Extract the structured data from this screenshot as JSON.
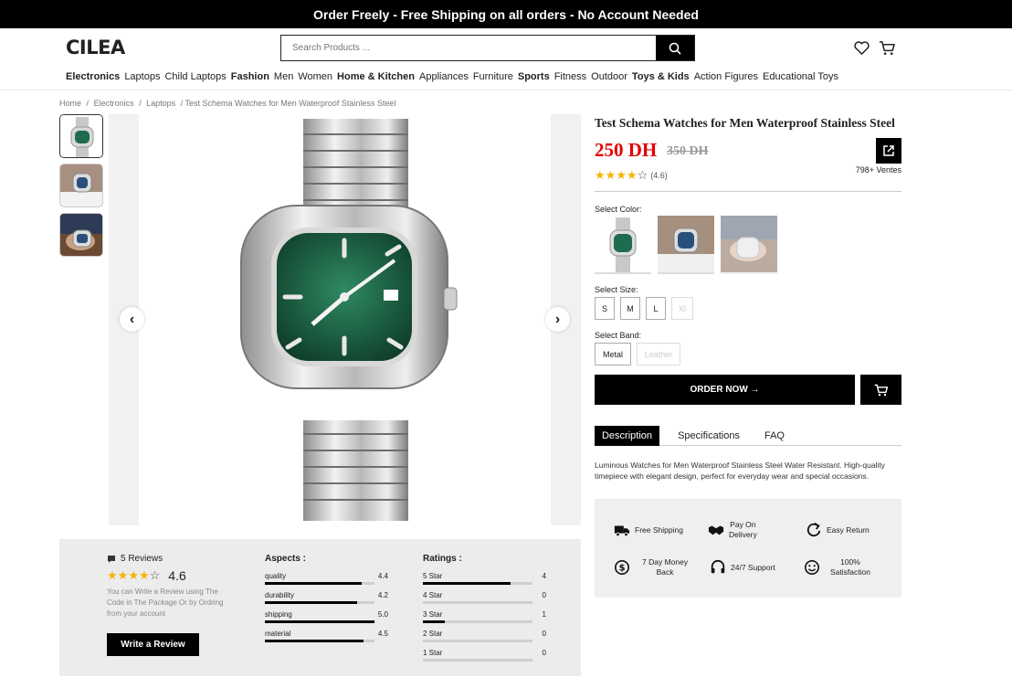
{
  "banner": "Order Freely - Free Shipping on all orders - No Account Needed",
  "header": {
    "logo": "CILEA",
    "search_placeholder": "Search Products ...",
    "icons": [
      "search-icon",
      "heart-icon",
      "cart-icon"
    ]
  },
  "nav": [
    {
      "label": "Electronics",
      "bold": true
    },
    {
      "label": "Laptops",
      "bold": false
    },
    {
      "label": "Child Laptops",
      "bold": false
    },
    {
      "label": "Fashion",
      "bold": true
    },
    {
      "label": "Men",
      "bold": false
    },
    {
      "label": "Women",
      "bold": false
    },
    {
      "label": "Home & Kitchen",
      "bold": true
    },
    {
      "label": "Appliances",
      "bold": false
    },
    {
      "label": "Furniture",
      "bold": false
    },
    {
      "label": "Sports",
      "bold": true
    },
    {
      "label": "Fitness",
      "bold": false
    },
    {
      "label": "Outdoor",
      "bold": false
    },
    {
      "label": "Toys & Kids",
      "bold": true
    },
    {
      "label": "Action Figures",
      "bold": false
    },
    {
      "label": "Educational Toys",
      "bold": false
    }
  ],
  "breadcrumb": [
    "Home",
    "/",
    "Electronics",
    "/",
    "Laptops",
    "/ Test Schema Watches for Men Waterproof Stainless Steel"
  ],
  "product": {
    "title": "Test Schema Watches for Men Waterproof Stainless Steel",
    "price": "250 DH",
    "old_price": "350 DH",
    "rating": "(4.6)",
    "rating_value": 4.6,
    "sold": "798+ Ventes",
    "select_color_label": "Select Color:",
    "select_size_label": "Select Size:",
    "sizes": [
      {
        "label": "S",
        "available": true
      },
      {
        "label": "M",
        "available": true
      },
      {
        "label": "L",
        "available": true
      },
      {
        "label": "Xl",
        "available": false
      }
    ],
    "select_band_label": "Select Band:",
    "bands": [
      {
        "label": "Metal",
        "available": true
      },
      {
        "label": "Leather",
        "available": false
      }
    ],
    "order_button": "ORDER NOW →",
    "tabs": [
      "Description",
      "Specifications",
      "FAQ"
    ],
    "description": "Luminous Watches for Men Waterproof Stainless Steel Water Resistant. High-quality timepiece with elegant design, perfect for everyday wear and special occasions."
  },
  "features": [
    {
      "icon": "truck-icon",
      "label": "Free Shipping"
    },
    {
      "icon": "handshake-icon",
      "label": "Pay On\nDelivery"
    },
    {
      "icon": "return-icon",
      "label": "Easy Return"
    },
    {
      "icon": "money-back-icon",
      "label": "7 Day Money\nBack"
    },
    {
      "icon": "headset-icon",
      "label": "24/7 Support"
    },
    {
      "icon": "smile-icon",
      "label": "100%\nSatisfaction"
    }
  ],
  "reviews": {
    "count_label": "5 Reviews",
    "average": "4.6",
    "note": "You can Write a Review using The Code in The Package Or by Ordring from your account",
    "write_button": "Write a Review",
    "aspects_title": "Aspects :",
    "aspects": [
      {
        "label": "quality",
        "value": "4.4",
        "score": 4.4
      },
      {
        "label": "durability",
        "value": "4.2",
        "score": 4.2
      },
      {
        "label": "shipping",
        "value": "5.0",
        "score": 5.0
      },
      {
        "label": "material",
        "value": "4.5",
        "score": 4.5
      }
    ],
    "ratings_title": "Ratings :",
    "ratings": [
      {
        "label": "5 Star",
        "value": "4",
        "count": 4
      },
      {
        "label": "4 Star",
        "value": "0",
        "count": 0
      },
      {
        "label": "3 Star",
        "value": "1",
        "count": 1
      },
      {
        "label": "2 Star",
        "value": "0",
        "count": 0
      },
      {
        "label": "1 Star",
        "value": "0",
        "count": 0
      }
    ]
  },
  "colors": {
    "accent": "#000000",
    "price": "#e30000",
    "star": "#f5b301"
  }
}
